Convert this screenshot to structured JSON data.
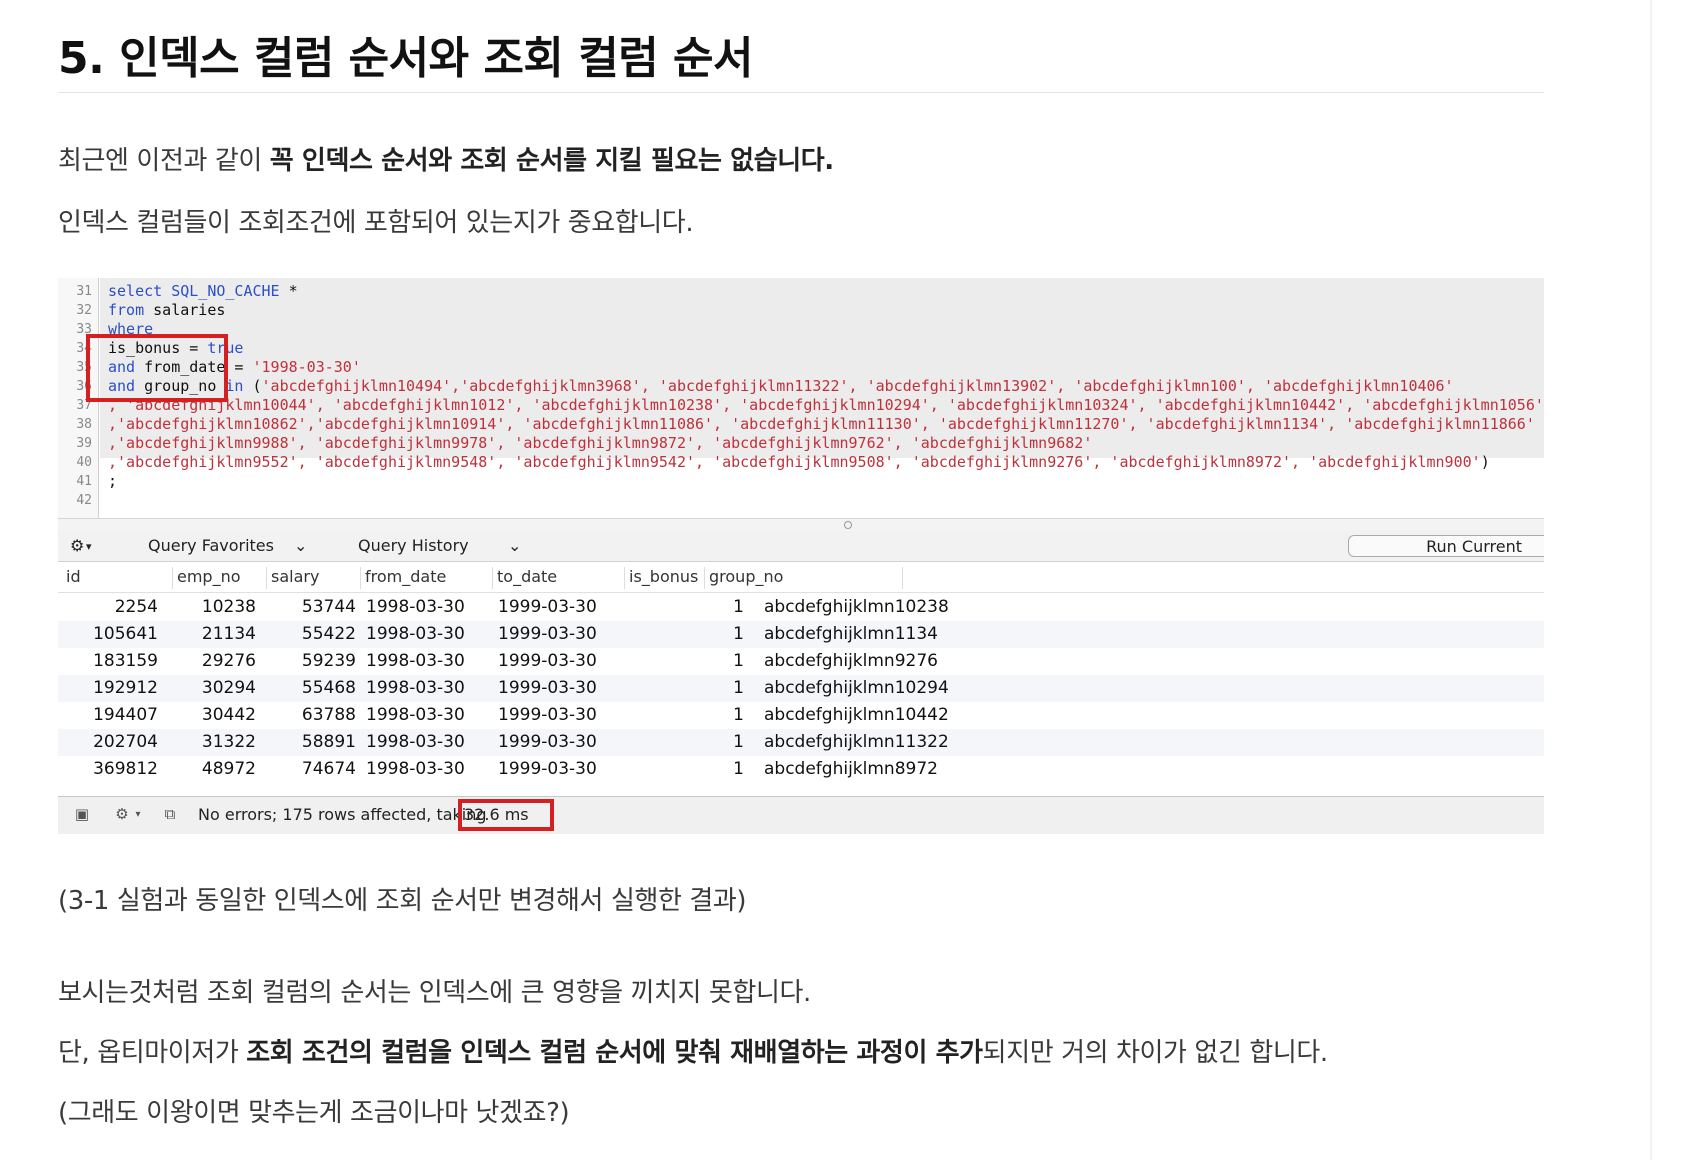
{
  "title": "5. 인덱스 컬럼 순서와 조회 컬럼 순서",
  "intro": {
    "line1_pre": "최근엔 이전과 같이 ",
    "line1_bold": "꼭 인덱스 순서와 조회 순서를 지킬 필요는 없습니다.",
    "line2": "인덱스 컬럼들이 조회조건에 포함되어 있는지가 중요합니다."
  },
  "editor": {
    "line_numbers": [
      "31",
      "32",
      "33",
      "34",
      "35",
      "36",
      "37",
      "38",
      "39",
      "40",
      "41",
      "42"
    ],
    "l31_kw": "select SQL_NO_CACHE",
    "l31_rest": " *",
    "l32_kw": "from",
    "l32_rest": " salaries",
    "l33_kw": "where",
    "l34_rest": "is_bonus = ",
    "l34_kw": "true",
    "l35_kw": "and",
    "l35_rest": " from_date = ",
    "l35_str": "'1998-03-30'",
    "l36_kw": "and",
    "l36_rest": " group_no ",
    "l36_kw2": "in",
    "l36_paren": " (",
    "l36_str": "'abcdefghijklmn10494','abcdefghijklmn3968', 'abcdefghijklmn11322', 'abcdefghijklmn13902', 'abcdefghijklmn100', 'abcdefghijklmn10406'",
    "l37_str": ", 'abcdefghijklmn10044', 'abcdefghijklmn1012', 'abcdefghijklmn10238', 'abcdefghijklmn10294', 'abcdefghijklmn10324', 'abcdefghijklmn10442', 'abcdefghijklmn1056'",
    "l38_str": ",'abcdefghijklmn10862','abcdefghijklmn10914', 'abcdefghijklmn11086', 'abcdefghijklmn11130', 'abcdefghijklmn11270', 'abcdefghijklmn1134', 'abcdefghijklmn11866'",
    "l39_str": ",'abcdefghijklmn9988', 'abcdefghijklmn9978', 'abcdefghijklmn9872', 'abcdefghijklmn9762', 'abcdefghijklmn9682'",
    "l40_str": ",'abcdefghijklmn9552', 'abcdefghijklmn9548', 'abcdefghijklmn9542', 'abcdefghijklmn9508', 'abcdefghijklmn9276', 'abcdefghijklmn8972', 'abcdefghijklmn900'",
    "l40_close": ")",
    "l41": ";"
  },
  "toolbar": {
    "gear": "⚙",
    "query_favorites": "Query Favorites",
    "query_history": "Query History",
    "chevron": "⌄",
    "run_current": "Run Current"
  },
  "grid": {
    "headers": [
      "id",
      "emp_no",
      "salary",
      "from_date",
      "to_date",
      "is_bonus",
      "group_no"
    ],
    "rows": [
      [
        "2254",
        "10238",
        "53744",
        "1998-03-30",
        "1999-03-30",
        "1",
        "abcdefghijklmn10238"
      ],
      [
        "105641",
        "21134",
        "55422",
        "1998-03-30",
        "1999-03-30",
        "1",
        "abcdefghijklmn1134"
      ],
      [
        "183159",
        "29276",
        "59239",
        "1998-03-30",
        "1999-03-30",
        "1",
        "abcdefghijklmn9276"
      ],
      [
        "192912",
        "30294",
        "55468",
        "1998-03-30",
        "1999-03-30",
        "1",
        "abcdefghijklmn10294"
      ],
      [
        "194407",
        "30442",
        "63788",
        "1998-03-30",
        "1999-03-30",
        "1",
        "abcdefghijklmn10442"
      ],
      [
        "202704",
        "31322",
        "58891",
        "1998-03-30",
        "1999-03-30",
        "1",
        "abcdefghijklmn11322"
      ],
      [
        "369812",
        "48972",
        "74674",
        "1998-03-30",
        "1999-03-30",
        "1",
        "abcdefghijklmn8972"
      ]
    ]
  },
  "status": {
    "message": "No errors; 175 rows affected, taking",
    "time": "32.6 ms"
  },
  "caption": "(3-1 실험과 동일한 인덱스에 조회 순서만 변경해서 실행한 결과)",
  "outro": {
    "line1": "보시는것처럼 조회 컬럼의 순서는 인덱스에 큰 영향을 끼치지 못합니다.",
    "line2_pre": "단, 옵티마이저가 ",
    "line2_bold": "조회 조건의 컬럼을 인덱스 컬럼 순서에 맞춰 재배열하는 과정이 추가",
    "line2_post": "되지만 거의 차이가 없긴 합니다.",
    "line3": "(그래도 이왕이면 맞추는게 조금이나마 낫겠죠?)"
  },
  "colors": {
    "highlight_box": "#d42020",
    "keyword": "#2b4fc9",
    "string": "#c0303a"
  }
}
